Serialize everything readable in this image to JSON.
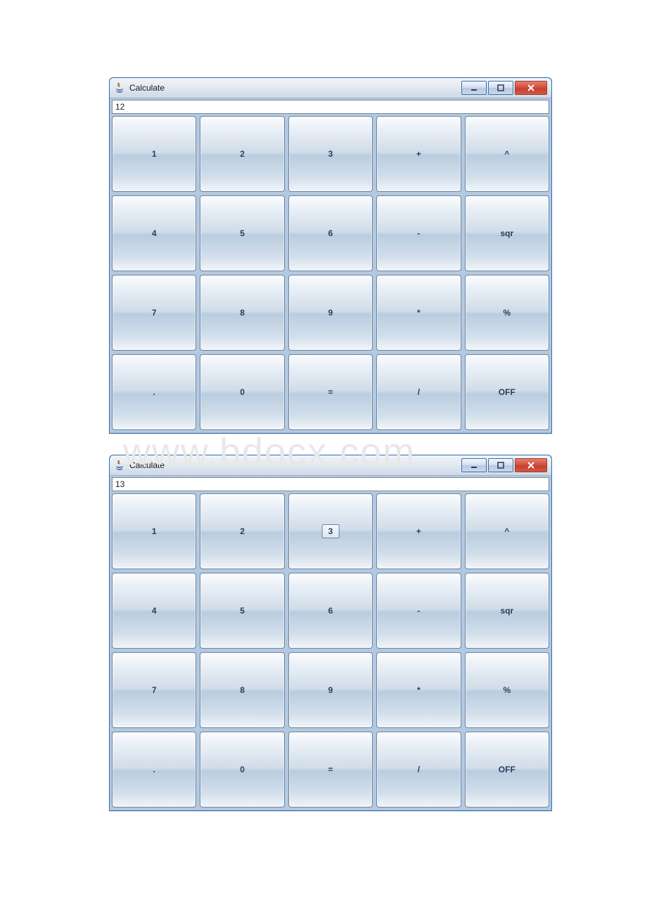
{
  "watermark": "www.bdocx.com",
  "windows": [
    {
      "title": "Calculate",
      "display_value": "12",
      "buttons": [
        {
          "id": "btn-1",
          "label": "1"
        },
        {
          "id": "btn-2",
          "label": "2"
        },
        {
          "id": "btn-3",
          "label": "3"
        },
        {
          "id": "btn-plus",
          "label": "+"
        },
        {
          "id": "btn-pow",
          "label": "^"
        },
        {
          "id": "btn-4",
          "label": "4"
        },
        {
          "id": "btn-5",
          "label": "5"
        },
        {
          "id": "btn-6",
          "label": "6"
        },
        {
          "id": "btn-minus",
          "label": "-"
        },
        {
          "id": "btn-sqr",
          "label": "sqr"
        },
        {
          "id": "btn-7",
          "label": "7"
        },
        {
          "id": "btn-8",
          "label": "8"
        },
        {
          "id": "btn-9",
          "label": "9"
        },
        {
          "id": "btn-mul",
          "label": "*"
        },
        {
          "id": "btn-pct",
          "label": "%"
        },
        {
          "id": "btn-dot",
          "label": "."
        },
        {
          "id": "btn-0",
          "label": "0"
        },
        {
          "id": "btn-eq",
          "label": "="
        },
        {
          "id": "btn-div",
          "label": "/"
        },
        {
          "id": "btn-off",
          "label": "OFF"
        }
      ],
      "pressed_index": null
    },
    {
      "title": "Calculate",
      "display_value": "13",
      "buttons": [
        {
          "id": "btn-1",
          "label": "1"
        },
        {
          "id": "btn-2",
          "label": "2"
        },
        {
          "id": "btn-3",
          "label": "3"
        },
        {
          "id": "btn-plus",
          "label": "+"
        },
        {
          "id": "btn-pow",
          "label": "^"
        },
        {
          "id": "btn-4",
          "label": "4"
        },
        {
          "id": "btn-5",
          "label": "5"
        },
        {
          "id": "btn-6",
          "label": "6"
        },
        {
          "id": "btn-minus",
          "label": "-"
        },
        {
          "id": "btn-sqr",
          "label": "sqr"
        },
        {
          "id": "btn-7",
          "label": "7"
        },
        {
          "id": "btn-8",
          "label": "8"
        },
        {
          "id": "btn-9",
          "label": "9"
        },
        {
          "id": "btn-mul",
          "label": "*"
        },
        {
          "id": "btn-pct",
          "label": "%"
        },
        {
          "id": "btn-dot",
          "label": "."
        },
        {
          "id": "btn-0",
          "label": "0"
        },
        {
          "id": "btn-eq",
          "label": "="
        },
        {
          "id": "btn-div",
          "label": "/"
        },
        {
          "id": "btn-off",
          "label": "OFF"
        }
      ],
      "pressed_index": 2
    }
  ]
}
